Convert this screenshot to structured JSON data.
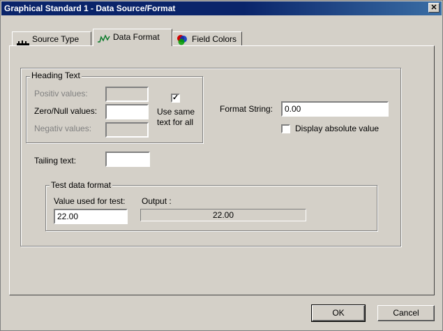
{
  "window": {
    "title": "Graphical Standard 1 - Data Source/Format",
    "close_glyph": "✕"
  },
  "tabs": [
    {
      "label": "Source Type",
      "icon": "ruler-icon"
    },
    {
      "label": "Data Format",
      "icon": "waveform-icon"
    },
    {
      "label": "Field Colors",
      "icon": "color-wheel-icon"
    }
  ],
  "heading_text": {
    "legend": "Heading Text",
    "positive_label": "Positiv values:",
    "positive_value": "",
    "zero_label": "Zero/Null values:",
    "zero_value": "",
    "negative_label": "Negativ values:",
    "negative_value": "",
    "use_same_checked": true,
    "check_glyph": "✓",
    "use_same_label_line1": "Use same",
    "use_same_label_line2": "text for all"
  },
  "tailing": {
    "label": "Tailing text:",
    "value": ""
  },
  "format": {
    "label": "Format String:",
    "value": "0.00",
    "absolute_checked": false,
    "absolute_label": "Display absolute value"
  },
  "test": {
    "legend": "Test data format",
    "value_label": "Value used for test:",
    "value": "22.00",
    "output_label": "Output :",
    "output_value": "22.00"
  },
  "buttons": {
    "ok": "OK",
    "cancel": "Cancel"
  }
}
